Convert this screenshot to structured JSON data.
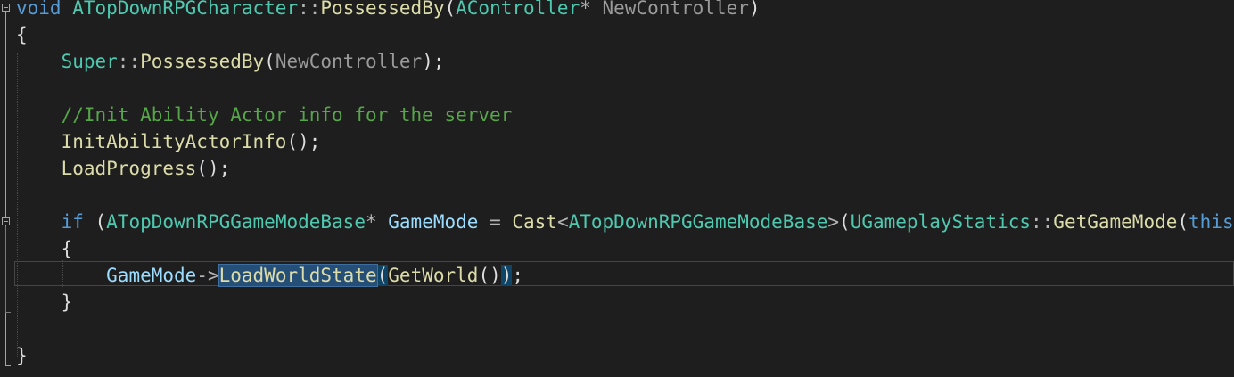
{
  "editor": {
    "lines": [
      {
        "tokens": [
          {
            "t": "void",
            "c": "kw"
          },
          {
            "t": " ",
            "c": "pu"
          },
          {
            "t": "ATopDownRPGCharacter",
            "c": "ty"
          },
          {
            "t": "::",
            "c": "op"
          },
          {
            "t": "PossessedBy",
            "c": "fn"
          },
          {
            "t": "(",
            "c": "pu"
          },
          {
            "t": "AController",
            "c": "ty"
          },
          {
            "t": "* ",
            "c": "op"
          },
          {
            "t": "NewController",
            "c": "pm"
          },
          {
            "t": ")",
            "c": "pu"
          }
        ]
      },
      {
        "tokens": [
          {
            "t": "{",
            "c": "pu"
          }
        ]
      },
      {
        "tokens": [
          {
            "t": "    ",
            "c": "pu"
          },
          {
            "t": "Super",
            "c": "ty"
          },
          {
            "t": "::",
            "c": "op"
          },
          {
            "t": "PossessedBy",
            "c": "fn"
          },
          {
            "t": "(",
            "c": "pu"
          },
          {
            "t": "NewController",
            "c": "pm"
          },
          {
            "t": ");",
            "c": "pu"
          }
        ]
      },
      {
        "tokens": []
      },
      {
        "tokens": [
          {
            "t": "    ",
            "c": "pu"
          },
          {
            "t": "//Init Ability Actor info for the server",
            "c": "cm"
          }
        ]
      },
      {
        "tokens": [
          {
            "t": "    ",
            "c": "pu"
          },
          {
            "t": "InitAbilityActorInfo",
            "c": "fn"
          },
          {
            "t": "();",
            "c": "pu"
          }
        ]
      },
      {
        "tokens": [
          {
            "t": "    ",
            "c": "pu"
          },
          {
            "t": "LoadProgress",
            "c": "fn"
          },
          {
            "t": "();",
            "c": "pu"
          }
        ]
      },
      {
        "tokens": []
      },
      {
        "tokens": [
          {
            "t": "    ",
            "c": "pu"
          },
          {
            "t": "if",
            "c": "kw"
          },
          {
            "t": " (",
            "c": "pu"
          },
          {
            "t": "ATopDownRPGGameModeBase",
            "c": "ty"
          },
          {
            "t": "* ",
            "c": "op"
          },
          {
            "t": "GameMode",
            "c": "lv"
          },
          {
            "t": " = ",
            "c": "op"
          },
          {
            "t": "Cast",
            "c": "fn"
          },
          {
            "t": "<",
            "c": "op"
          },
          {
            "t": "ATopDownRPGGameModeBase",
            "c": "ty"
          },
          {
            "t": ">",
            "c": "op"
          },
          {
            "t": "(",
            "c": "pu"
          },
          {
            "t": "UGameplayStatics",
            "c": "ty"
          },
          {
            "t": "::",
            "c": "op"
          },
          {
            "t": "GetGameMode",
            "c": "fn"
          },
          {
            "t": "(",
            "c": "pu"
          },
          {
            "t": "this",
            "c": "kw"
          },
          {
            "t": ")))",
            "c": "pu"
          }
        ]
      },
      {
        "tokens": [
          {
            "t": "    ",
            "c": "pu"
          },
          {
            "t": "{",
            "c": "pu"
          }
        ]
      },
      {
        "tokens": [
          {
            "t": "        ",
            "c": "pu"
          },
          {
            "t": "GameMode",
            "c": "lv"
          },
          {
            "t": "->",
            "c": "op"
          },
          {
            "t": "LoadWorldState",
            "c": "fn sel"
          },
          {
            "t": "(",
            "c": "pu brace-hl"
          },
          {
            "t": "GetWorld",
            "c": "fn"
          },
          {
            "t": "()",
            "c": "pu"
          },
          {
            "t": ")",
            "c": "pu brace-hl"
          },
          {
            "t": ";",
            "c": "pu"
          }
        ]
      },
      {
        "tokens": [
          {
            "t": "    ",
            "c": "pu"
          },
          {
            "t": "}",
            "c": "pu"
          }
        ]
      },
      {
        "tokens": []
      },
      {
        "tokens": [
          {
            "t": "}",
            "c": "pu"
          }
        ]
      }
    ]
  }
}
